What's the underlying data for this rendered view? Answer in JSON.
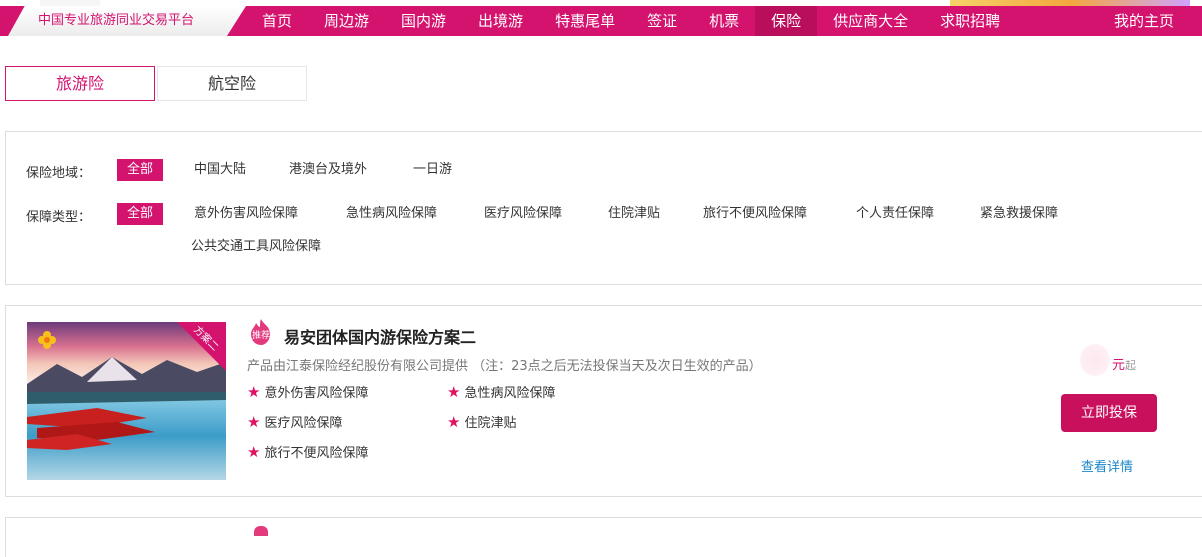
{
  "header": {
    "slogan": "中国专业旅游同业交易平台",
    "nav": [
      {
        "label": "首页"
      },
      {
        "label": "周边游"
      },
      {
        "label": "国内游"
      },
      {
        "label": "出境游"
      },
      {
        "label": "特惠尾单"
      },
      {
        "label": "签证"
      },
      {
        "label": "机票"
      },
      {
        "label": "保险",
        "active": true
      },
      {
        "label": "供应商大全"
      },
      {
        "label": "求职招聘"
      }
    ],
    "my_home": "我的主页"
  },
  "tabs": [
    {
      "label": "旅游险",
      "active": true
    },
    {
      "label": "航空险"
    }
  ],
  "filters": {
    "region": {
      "label": "保险地域：",
      "options": [
        "全部",
        "中国大陆",
        "港澳台及境外",
        "一日游"
      ],
      "selected": "全部"
    },
    "type": {
      "label": "保障类型：",
      "options": [
        "全部",
        "意外伤害风险保障",
        "急性病风险保障",
        "医疗风险保障",
        "住院津贴",
        "旅行不便风险保障",
        "个人责任保障",
        "紧急救援保障",
        "公共交通工具风险保障"
      ],
      "selected": "全部"
    }
  },
  "product": {
    "ribbon": "方案二",
    "badge": "推荐",
    "title": "易安团体国内游保险方案二",
    "provider": "产品由江泰保险经纪股份有限公司提供 （注：23点之后无法投保当天及次日生效的产品）",
    "features": [
      "意外伤害风险保障",
      "急性病风险保障",
      "医疗风险保障",
      "住院津贴",
      "旅行不便风险保障"
    ],
    "price_unit": "元",
    "price_suffix": "起",
    "buy_label": "立即投保",
    "detail_label": "查看详情"
  },
  "icons": {
    "star": "★",
    "recommend": "flame-badge-icon",
    "flower": "flower-icon"
  },
  "colors": {
    "brand": "#d4136f",
    "button": "#c8105d",
    "link": "#1a86c8"
  }
}
